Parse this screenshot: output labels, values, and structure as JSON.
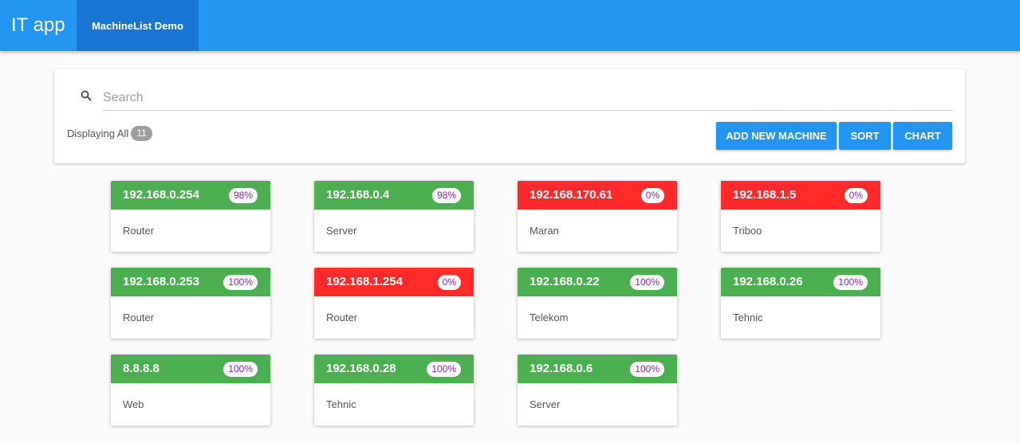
{
  "app": {
    "title": "IT app",
    "nav_tab": "MachineList Demo"
  },
  "search": {
    "placeholder": "Search",
    "value": ""
  },
  "summary": {
    "label": "Displaying All",
    "count": "11"
  },
  "buttons": {
    "add": "ADD NEW MACHINE",
    "sort": "SORT",
    "chart": "CHART"
  },
  "colors": {
    "accent": "#2196f3",
    "nav_active": "#1976d2",
    "status_up": "#4caf50",
    "status_down": "#ff2a2a",
    "percent_text": "#8e24aa"
  },
  "machines": [
    {
      "ip": "192.168.0.254",
      "percent": "98%",
      "name": "Router",
      "status": "up"
    },
    {
      "ip": "192.168.0.4",
      "percent": "98%",
      "name": "Server",
      "status": "up"
    },
    {
      "ip": "192.168.170.61",
      "percent": "0%",
      "name": "Maran",
      "status": "down"
    },
    {
      "ip": "192.168.1.5",
      "percent": "0%",
      "name": "Triboo",
      "status": "down"
    },
    {
      "ip": "192.168.0.253",
      "percent": "100%",
      "name": "Router",
      "status": "up"
    },
    {
      "ip": "192.168.1.254",
      "percent": "0%",
      "name": "Router",
      "status": "down"
    },
    {
      "ip": "192.168.0.22",
      "percent": "100%",
      "name": "Telekom",
      "status": "up"
    },
    {
      "ip": "192.168.0.26",
      "percent": "100%",
      "name": "Tehnic",
      "status": "up"
    },
    {
      "ip": "8.8.8.8",
      "percent": "100%",
      "name": "Web",
      "status": "up"
    },
    {
      "ip": "192.168.0.28",
      "percent": "100%",
      "name": "Tehnic",
      "status": "up"
    },
    {
      "ip": "192.168.0.6",
      "percent": "100%",
      "name": "Server",
      "status": "up"
    }
  ]
}
